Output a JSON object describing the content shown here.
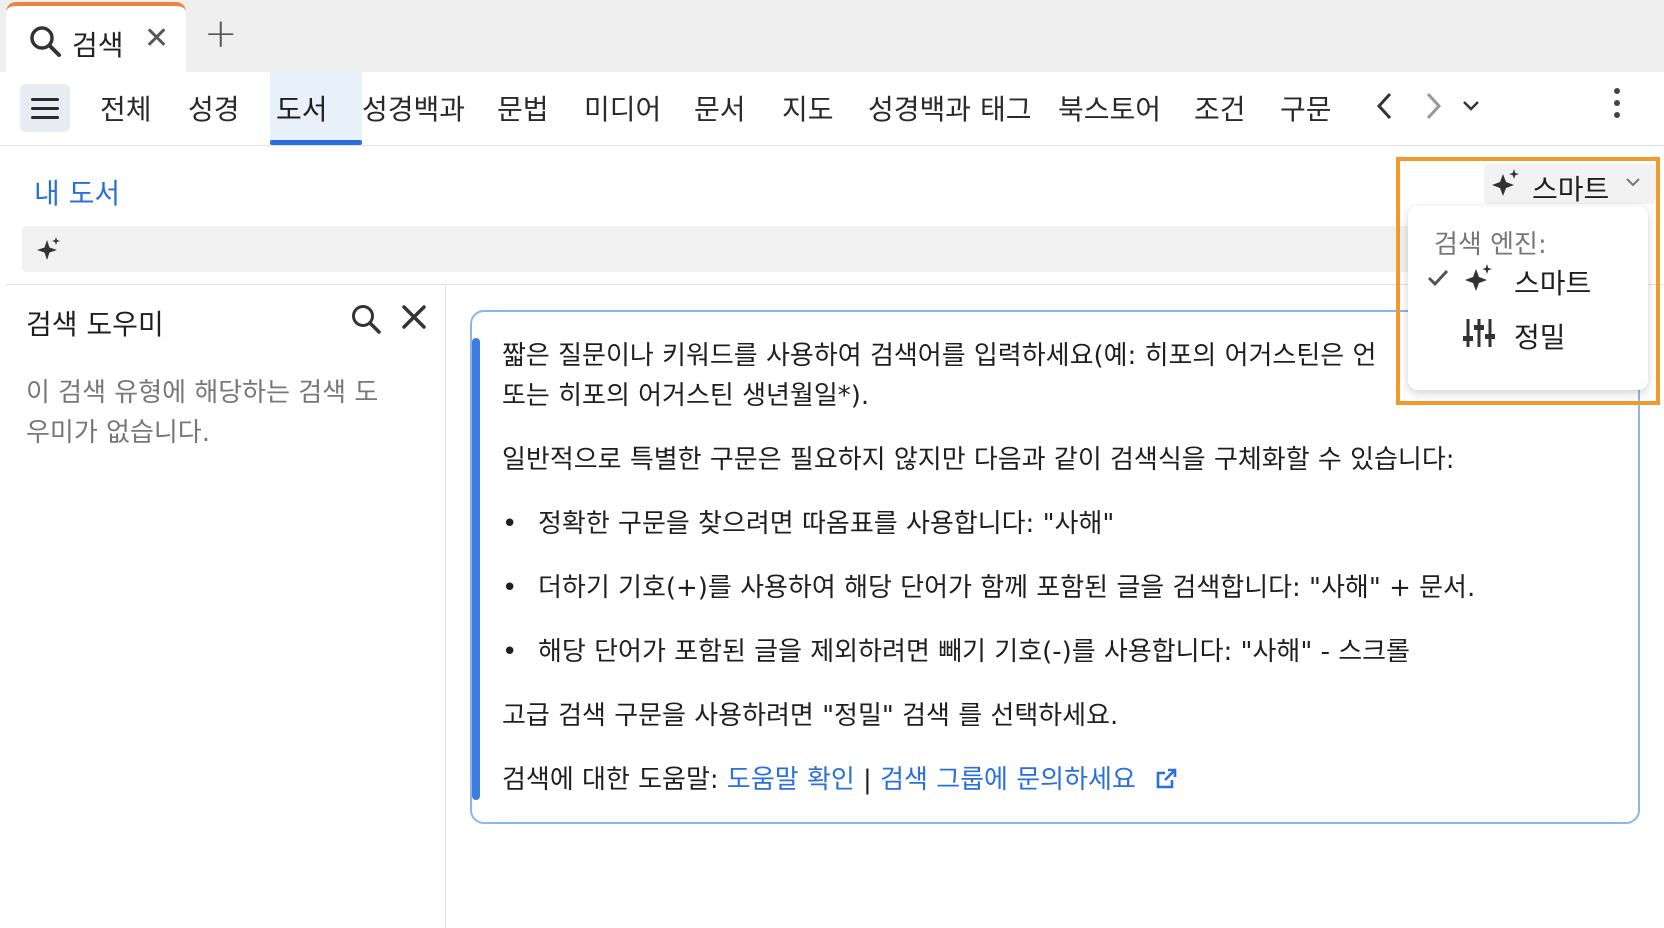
{
  "tab": {
    "title": "검색",
    "close": "✕",
    "add": "+"
  },
  "nav": {
    "items": [
      "전체",
      "성경",
      "도서",
      "성경백과",
      "문법",
      "미디어",
      "문서",
      "지도",
      "성경백과 태그",
      "북스토어",
      "조건",
      "구문"
    ],
    "active": "도서",
    "prev": "‹",
    "next": "›",
    "expand": "⌄"
  },
  "subbar": {
    "my_books": "내 도서"
  },
  "assistant": {
    "title": "검색 도우미",
    "empty_message": "이 검색 유형에 해당하는 검색 도우미가 없습니다."
  },
  "help": {
    "intro": "짧은 질문이나 키워드를 사용하여 검색어를 입력하세요(예: 히포의 어거스틴은 언",
    "intro2": "또는 히포의 어거스틴 생년월일*).",
    "general": "일반적으로 특별한 구문은 필요하지 않지만 다음과 같이 검색식을 구체화할 수 있습니다:",
    "tips": [
      "정확한 구문을 찾으려면 따옴표를 사용합니다: \"사해\"",
      "더하기 기호(+)를 사용하여 해당 단어가 함께 포함된 글을 검색합니다: \"사해\" + 문서.",
      "해당 단어가 포함된 글을 제외하려면 빼기 기호(-)를 사용합니다: \"사해\" - 스크롤"
    ],
    "advanced": "고급 검색 구문을 사용하려면 \"정밀\" 검색 를 선택하세요.",
    "help_prefix": "검색에 대한 도움말: ",
    "help_link": "도움말 확인",
    "separator": " | ",
    "group_link": "검색 그룹에 문의하세요"
  },
  "engine": {
    "button_label": "스마트",
    "menu_header": "검색 엔진:",
    "options": [
      {
        "label": "스마트",
        "selected": true,
        "icon": "sparkle-icon"
      },
      {
        "label": "정밀",
        "selected": false,
        "icon": "sliders-icon"
      }
    ],
    "check": "✓",
    "chevron": "⌄"
  },
  "colors": {
    "accent": "#2a6fdb",
    "highlight": "#f19a2e",
    "tab_accent": "#e8853a"
  }
}
